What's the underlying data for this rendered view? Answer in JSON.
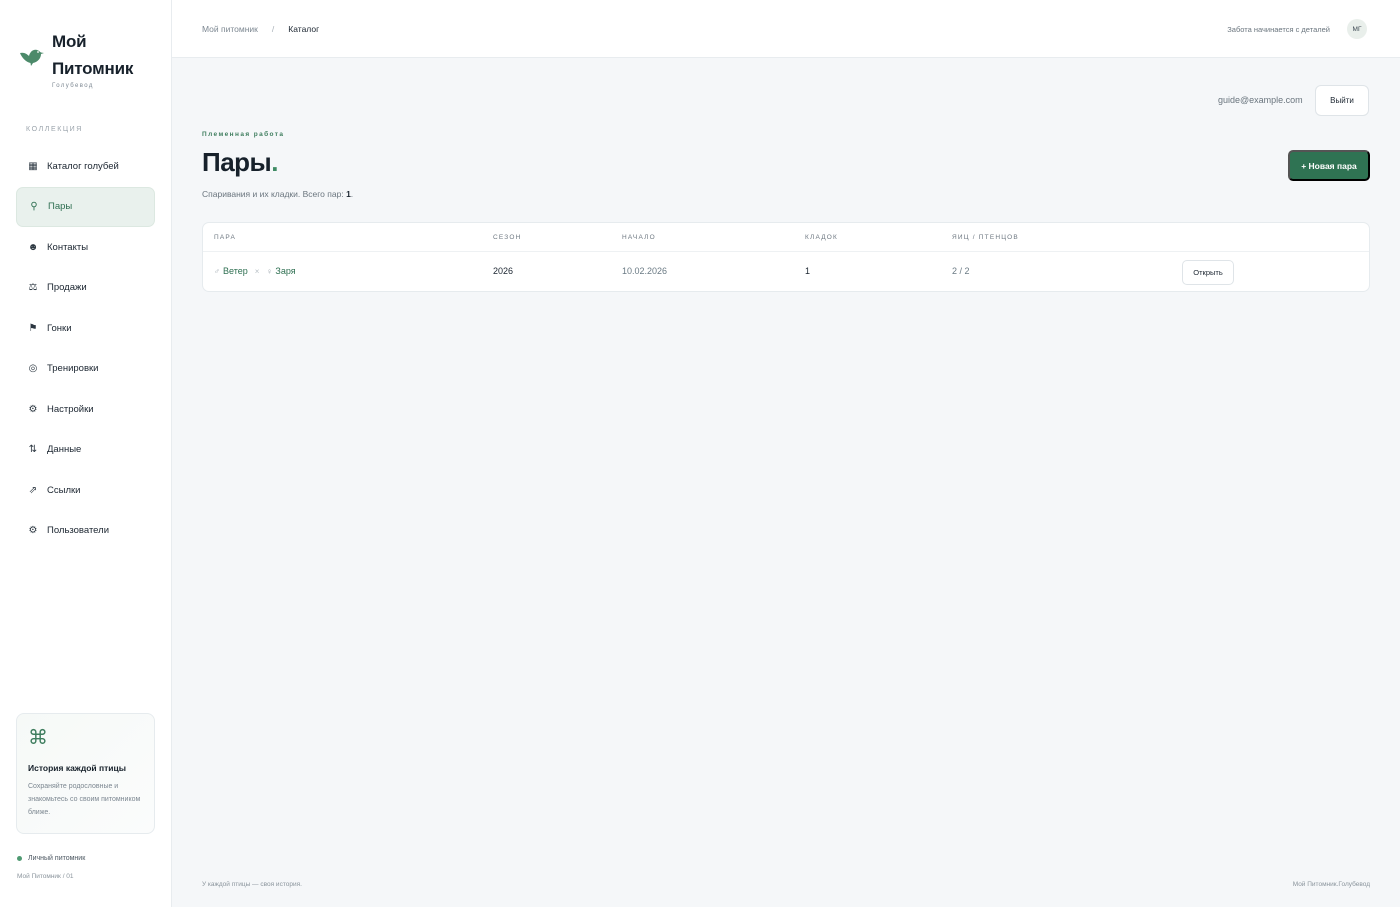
{
  "brand": {
    "title_line1": "Мой",
    "title_line2": "Питомник",
    "subtitle": "Голубевод",
    "accent_color": "#3e8b64"
  },
  "sidebar": {
    "section_label": "КОЛЛЕКЦИЯ",
    "items": [
      {
        "label": "Каталог голубей",
        "icon": "grid-icon",
        "glyph": "▦"
      },
      {
        "label": "Пары",
        "icon": "pin-icon",
        "glyph": "⚲",
        "active": true
      },
      {
        "label": "Контакты",
        "icon": "contacts-icon",
        "glyph": "☻"
      },
      {
        "label": "Продажи",
        "icon": "scales-icon",
        "glyph": "⚖"
      },
      {
        "label": "Гонки",
        "icon": "flag-icon",
        "glyph": "⚑"
      },
      {
        "label": "Тренировки",
        "icon": "target-icon",
        "glyph": "◎"
      },
      {
        "label": "Настройки",
        "icon": "gear-icon",
        "glyph": "⚙"
      },
      {
        "label": "Данные",
        "icon": "sort-arrows-icon",
        "glyph": "⇅"
      },
      {
        "label": "Ссылки",
        "icon": "link-arrow-icon",
        "glyph": "⇗"
      },
      {
        "label": "Пользователи",
        "icon": "users-gear-icon",
        "glyph": "⚙"
      }
    ],
    "promo": {
      "icon_glyph": "⌘",
      "title": "История каждой птицы",
      "text": "Сохраняйте родословные и знакомьтесь со своим питомником ближе."
    },
    "status_label": "Личный питомник",
    "version_label": "Мой Питомник / 01"
  },
  "topbar": {
    "crumb_home": "Мой питомник",
    "crumb_sep": "/",
    "crumb_current": "Каталог",
    "tagline": "Забота начинается с деталей",
    "avatar_initials": "МГ"
  },
  "session": {
    "email": "guide@example.com",
    "logout_label": "Выйти"
  },
  "page": {
    "eyebrow": "Племенная работа",
    "title": "Пары",
    "title_dot": ".",
    "subtitle_prefix": "Спаривания и их кладки. Всего пар: ",
    "total_pairs": "1",
    "subtitle_suffix": ".",
    "new_button": "+ Новая пара"
  },
  "table": {
    "columns": [
      "ПАРА",
      "СЕЗОН",
      "НАЧАЛО",
      "КЛАДОК",
      "ЯИЦ / ПТЕНЦОВ"
    ],
    "rows": [
      {
        "male_symbol": "♂",
        "male": "Ветер",
        "separator": "×",
        "female_symbol": "♀",
        "female": "Заря",
        "season": "2026",
        "start": "10.02.2026",
        "clutches": "1",
        "eggs_chicks": "2 / 2",
        "action": "Открыть"
      }
    ]
  },
  "footer": {
    "left": "У каждой птицы — своя история.",
    "right": "Мой Питомник.Голубевод"
  }
}
